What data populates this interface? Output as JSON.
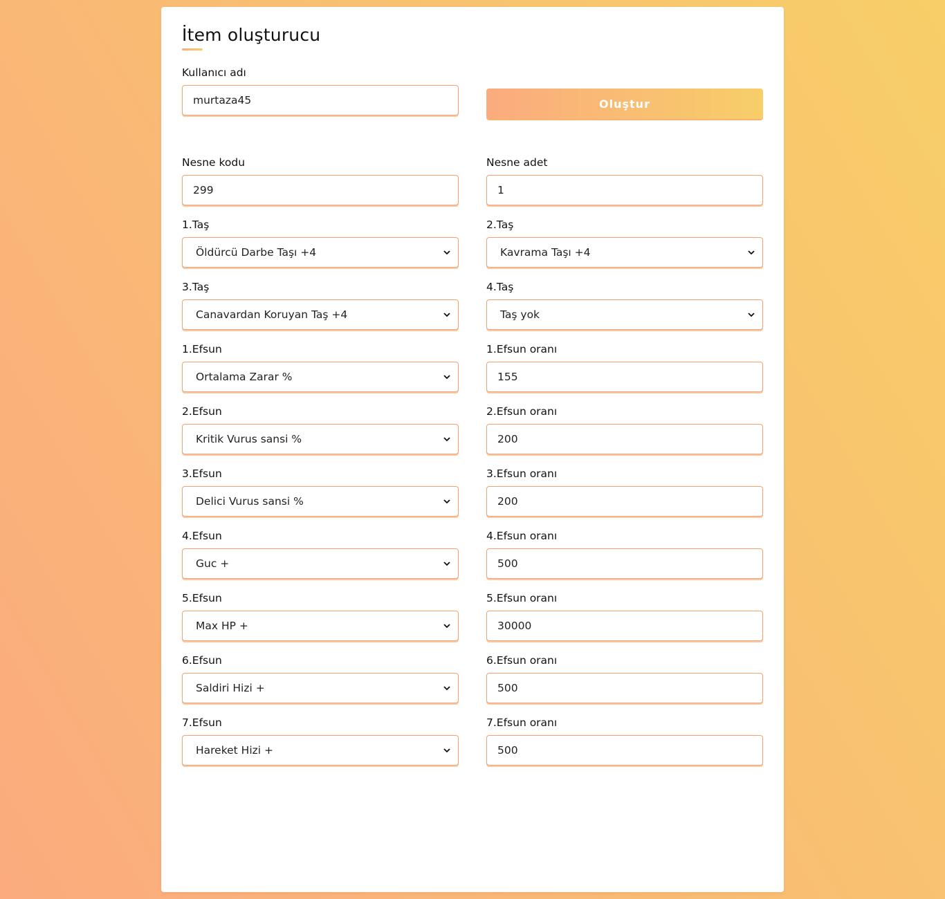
{
  "title": "İtem oluşturucu",
  "username": {
    "label": "Kullanıcı adı",
    "value": "murtaza45"
  },
  "submit_label": "Oluştur",
  "item_code": {
    "label": "Nesne kodu",
    "value": "299"
  },
  "item_count": {
    "label": "Nesne adet",
    "value": "1"
  },
  "stones": [
    {
      "label": "1.Taş",
      "value": "Öldürcü Darbe Taşı +4"
    },
    {
      "label": "2.Taş",
      "value": "Kavrama Taşı +4"
    },
    {
      "label": "3.Taş",
      "value": "Canavardan Koruyan Taş +4"
    },
    {
      "label": "4.Taş",
      "value": "Taş yok"
    }
  ],
  "bonuses": [
    {
      "label": "1.Efsun",
      "value": "Ortalama Zarar %",
      "rate_label": "1.Efsun oranı",
      "rate": "155"
    },
    {
      "label": "2.Efsun",
      "value": "Kritik Vurus sansi %",
      "rate_label": "2.Efsun oranı",
      "rate": "200"
    },
    {
      "label": "3.Efsun",
      "value": "Delici Vurus sansi %",
      "rate_label": "3.Efsun oranı",
      "rate": "200"
    },
    {
      "label": "4.Efsun",
      "value": "Guc +",
      "rate_label": "4.Efsun oranı",
      "rate": "500"
    },
    {
      "label": "5.Efsun",
      "value": "Max HP +",
      "rate_label": "5.Efsun oranı",
      "rate": "30000"
    },
    {
      "label": "6.Efsun",
      "value": "Saldiri Hizi +",
      "rate_label": "6.Efsun oranı",
      "rate": "500"
    },
    {
      "label": "7.Efsun",
      "value": "Hareket Hizi +",
      "rate_label": "7.Efsun oranı",
      "rate": "500"
    }
  ],
  "colors": {
    "accent_start": "#fbab7e",
    "accent_end": "#f7ce68",
    "border": "#f6a26a"
  }
}
